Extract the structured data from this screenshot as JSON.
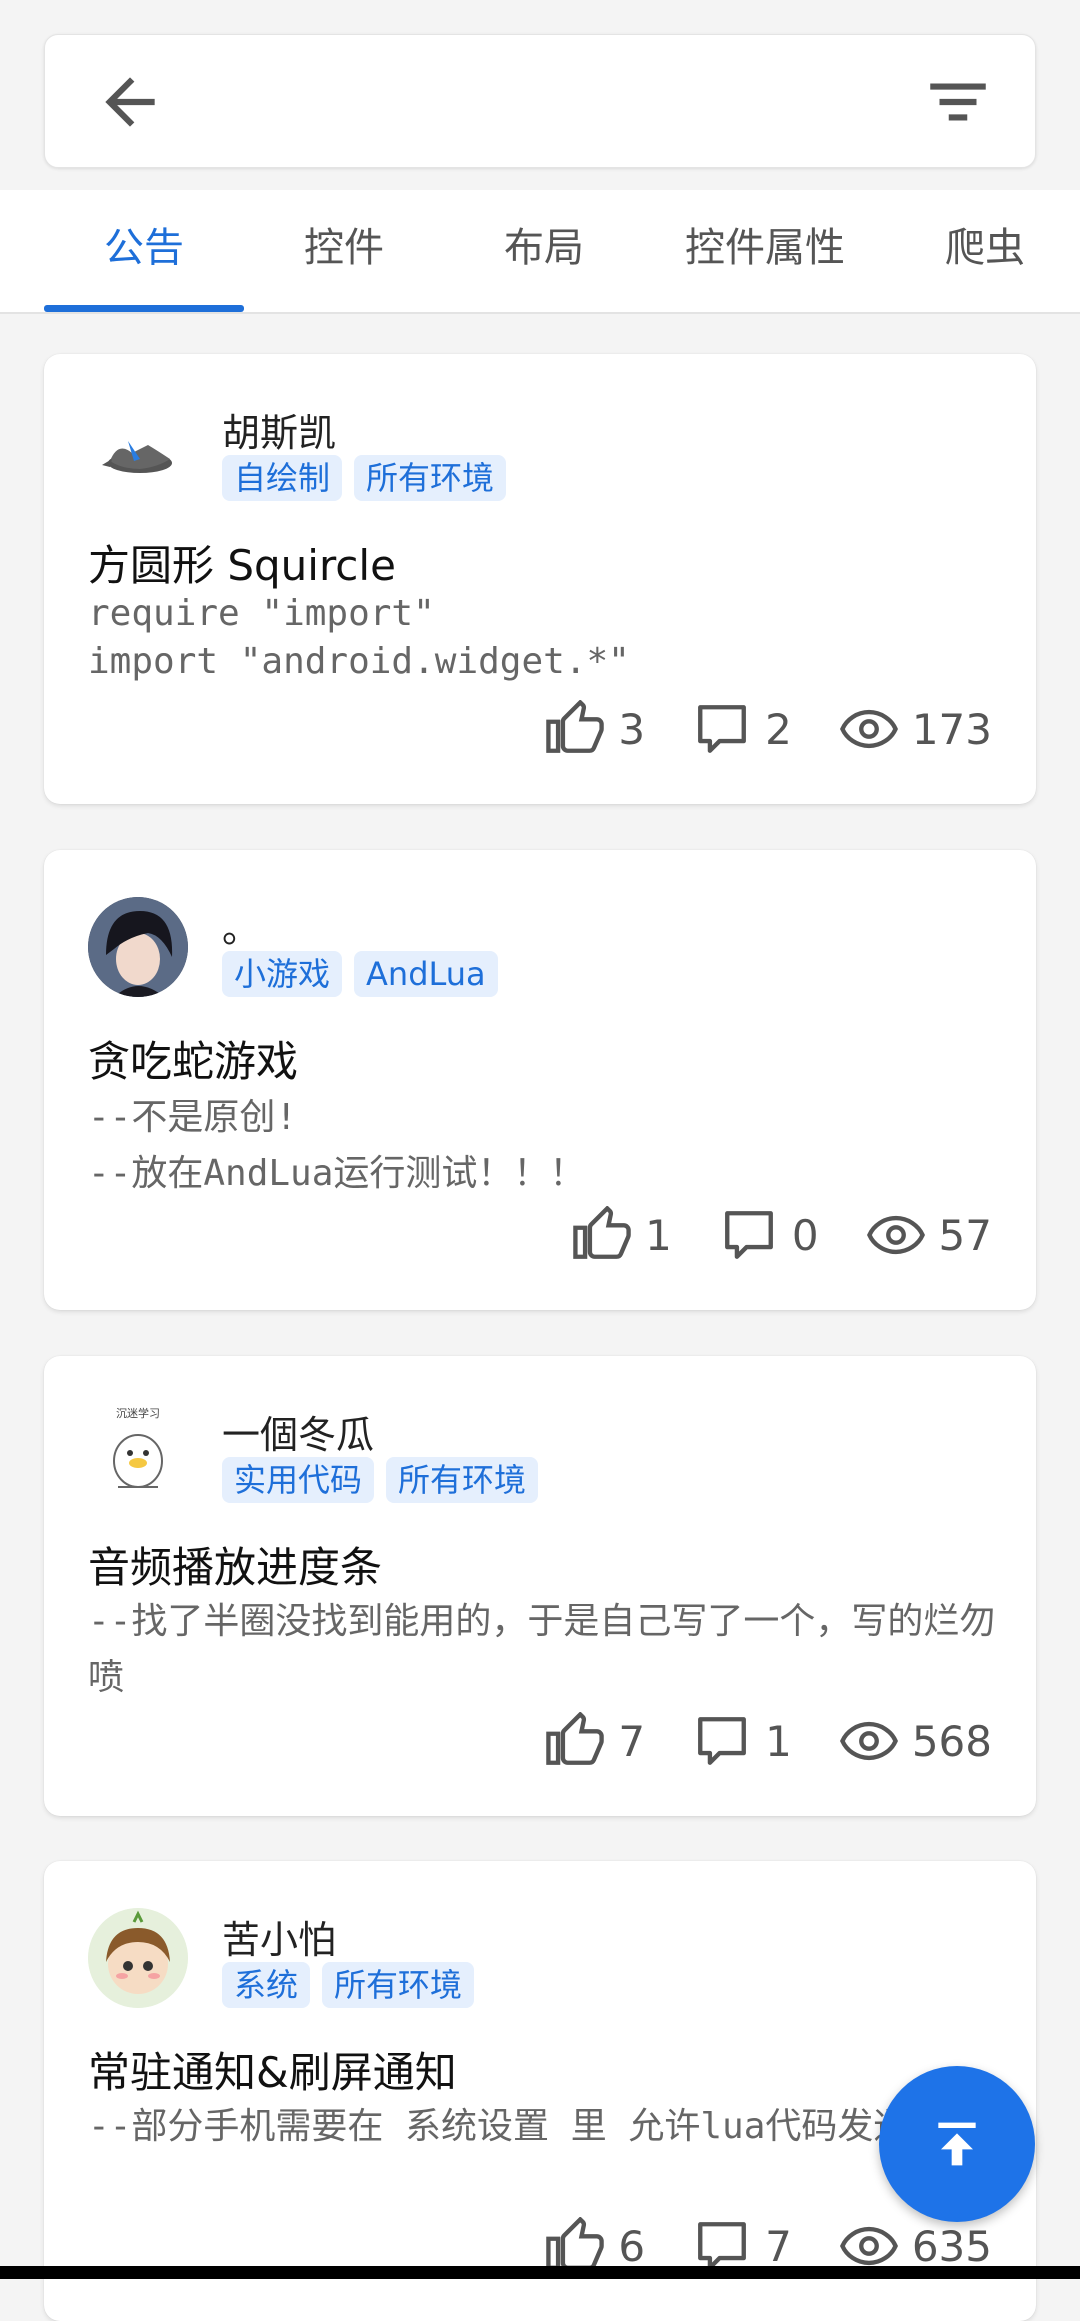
{
  "toolbar": {
    "back_icon": "arrow-left-icon",
    "filter_icon": "filter-icon"
  },
  "tabs": [
    {
      "label": "公告",
      "active": true
    },
    {
      "label": "控件",
      "active": false
    },
    {
      "label": "布局",
      "active": false
    },
    {
      "label": "控件属性",
      "active": false
    },
    {
      "label": "爬虫",
      "active": false
    }
  ],
  "colors": {
    "accent": "#1e6fd9",
    "tag_bg": "#e5effd"
  },
  "posts": [
    {
      "author": "胡斯凯",
      "tags": [
        "自绘制",
        "所有环境"
      ],
      "title": "方圆形 Squircle",
      "excerpt": "require \"import\"\nimport \"android.widget.*\"",
      "likes": "3",
      "comments": "2",
      "views": "173"
    },
    {
      "author": "。",
      "tags": [
        "小游戏",
        "AndLua"
      ],
      "title": "贪吃蛇游戏",
      "excerpt": "--不是原创!\n--放在AndLua运行测试！！！",
      "likes": "1",
      "comments": "0",
      "views": "57"
    },
    {
      "author": "一個冬瓜",
      "tags": [
        "实用代码",
        "所有环境"
      ],
      "title": "音频播放进度条",
      "excerpt": "--找了半圈没找到能用的，于是自己写了一个，写的烂勿喷",
      "likes": "7",
      "comments": "1",
      "views": "568"
    },
    {
      "author": "苦小怕",
      "tags": [
        "系统",
        "所有环境"
      ],
      "title": "常驻通知&刷屏通知",
      "excerpt": "--部分手机需要在 系统设置 里 允许lua代码发通知",
      "likes": "6",
      "comments": "7",
      "views": "635"
    }
  ],
  "fab": {
    "icon": "scroll-to-top-icon"
  }
}
